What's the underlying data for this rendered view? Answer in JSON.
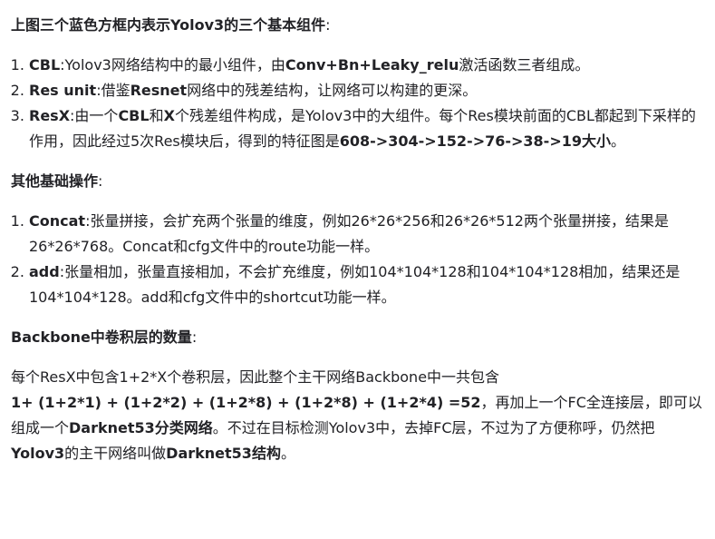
{
  "section1": {
    "title": "上图三个蓝色方框内表示Yolov3的三个基本组件",
    "title_colon": ":",
    "items": [
      {
        "term": "CBL",
        "sep": ":",
        "text_a": "Yolov3网络结构中的最小组件，由",
        "bold_b": "Conv+Bn+Leaky_relu",
        "text_c": "激活函数三者组成。"
      },
      {
        "term": "Res unit",
        "sep": ":",
        "text_a": "借鉴",
        "bold_b": "Resnet",
        "text_c": "网络中的残差结构，让网络可以构建的更深。"
      },
      {
        "term": "ResX",
        "sep": ":",
        "text_a": "由一个",
        "bold_b": "CBL",
        "text_c": "和",
        "bold_d": "X",
        "text_e": "个残差组件构成，是Yolov3中的大组件。每个Res模块前面的CBL都起到下采样的作用，因此经过5次Res模块后，得到的特征图是",
        "bold_f": "608->304->152->76->38->19大小",
        "text_g": "。"
      }
    ]
  },
  "section2": {
    "title": "其他基础操作",
    "title_colon": ":",
    "items": [
      {
        "term": "Concat",
        "sep": ":",
        "text": "张量拼接，会扩充两个张量的维度，例如26*26*256和26*26*512两个张量拼接，结果是26*26*768。Concat和cfg文件中的route功能一样。"
      },
      {
        "term": "add",
        "sep": ":",
        "text": "张量相加，张量直接相加，不会扩充维度，例如104*104*128和104*104*128相加，结果还是104*104*128。add和cfg文件中的shortcut功能一样。"
      }
    ]
  },
  "section3": {
    "title": "Backbone中卷积层的数量",
    "title_colon": ":",
    "line1": "每个ResX中包含1+2*X个卷积层，因此整个主干网络Backbone中一共包含",
    "formula": "1+ (1+2*1) + (1+2*2) + (1+2*8) + (1+2*8) + (1+2*4) =52",
    "text_a": "，再加上一个FC全连接层，即可以组成一个",
    "bold_b": "Darknet53分类网络",
    "text_c": "。不过在目标检测Yolov3中，去掉FC层，不过为了方便称呼，仍然把",
    "bold_d": "Yolov3",
    "text_e": "的主干网络叫做",
    "bold_f": "Darknet53结构",
    "text_g": "。"
  }
}
